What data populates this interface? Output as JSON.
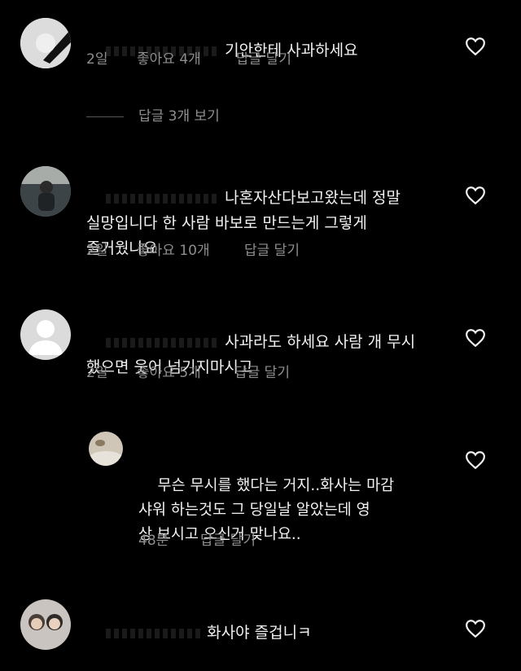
{
  "comments": [
    {
      "text": "기안한테 사과하세요",
      "time": "2일",
      "likes": "좋아요 4개",
      "reply": "답글 달기"
    },
    {
      "text": "나혼자산다보고왔는데 정말\n실망입니다 한 사람 바보로 만드는게 그렇게\n즐거웠나요",
      "time": "2일",
      "likes": "좋아요 10개",
      "reply": "답글 달기"
    },
    {
      "text": "사과라도 하세요 사람 개 무시\n했으면 웃어 넘기지마시고",
      "time": "2일",
      "likes": "좋아요 5개",
      "reply": "답글 달기"
    },
    {
      "text": "무슨 무시를 했다는 거지..화사는 마감\n샤워 하는것도 그 당일날 알았는데 영\n상 보시고 오신거 맞나요..",
      "time": "48분",
      "reply": "답글 달기"
    },
    {
      "text": "화사야 즐겁니ㅋ"
    }
  ],
  "view_replies": "답글 3개 보기",
  "icons": {
    "heart": "heart-outline-icon"
  },
  "colors": {
    "background": "#000000",
    "text": "#f2f2f2",
    "muted": "#8e8e8e"
  }
}
